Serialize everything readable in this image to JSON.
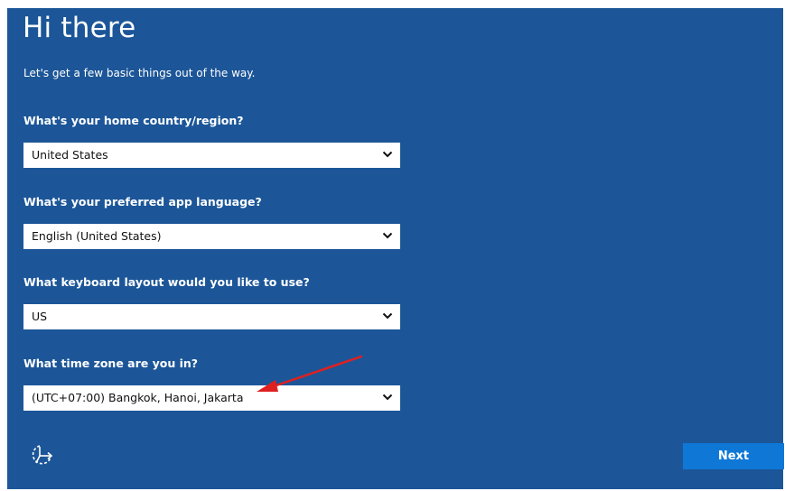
{
  "header": {
    "title": "Hi there",
    "subtitle": "Let's get a few basic things out of the way."
  },
  "questions": [
    {
      "label": "What's your home country/region?",
      "value": "United States"
    },
    {
      "label": "What's your preferred app language?",
      "value": "English (United States)"
    },
    {
      "label": "What keyboard layout would you like to use?",
      "value": "US"
    },
    {
      "label": "What time zone are you in?",
      "value": "(UTC+07:00) Bangkok, Hanoi, Jakarta"
    }
  ],
  "footer": {
    "accessibility_icon": "ease-of-access-icon",
    "next_label": "Next"
  },
  "colors": {
    "background": "#1c5698",
    "button": "#0f78d7",
    "annotation_arrow": "#e02020"
  }
}
